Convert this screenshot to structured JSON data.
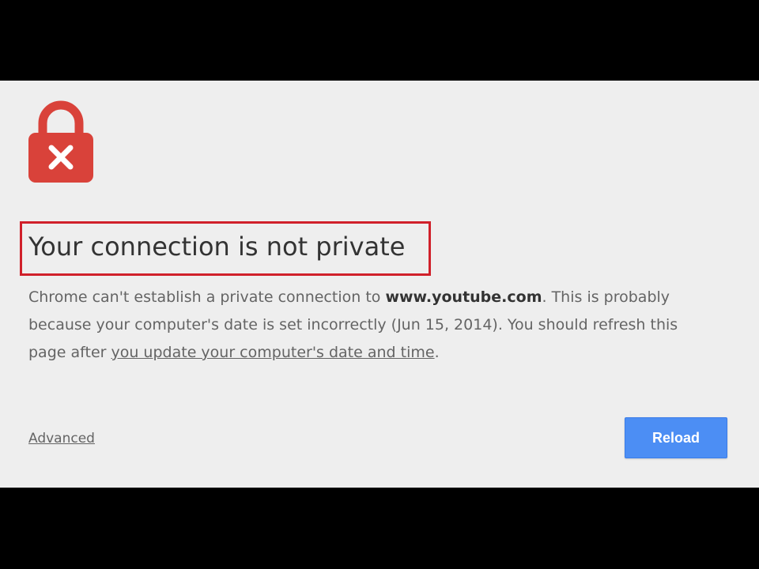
{
  "interstitial": {
    "heading": "Your connection is not private",
    "message": {
      "part1": "Chrome can't establish a private connection to ",
      "domain": "www.youtube.com",
      "part2": ". This is probably because your computer's date is set incorrectly (Jun 15, 2014). You should refresh this page after ",
      "link_text": "you update your computer's date and time",
      "part3": "."
    },
    "advanced_label": "Advanced",
    "reload_label": "Reload",
    "icon": "lock-with-x-icon"
  },
  "colors": {
    "page_background": "#eeeeee",
    "letterbox": "#000000",
    "lock_red": "#d9423a",
    "highlight_border": "#d0202a",
    "heading_text": "#333333",
    "body_text": "#646464",
    "button_blue": "#4c8ef4",
    "button_text": "#ffffff"
  }
}
